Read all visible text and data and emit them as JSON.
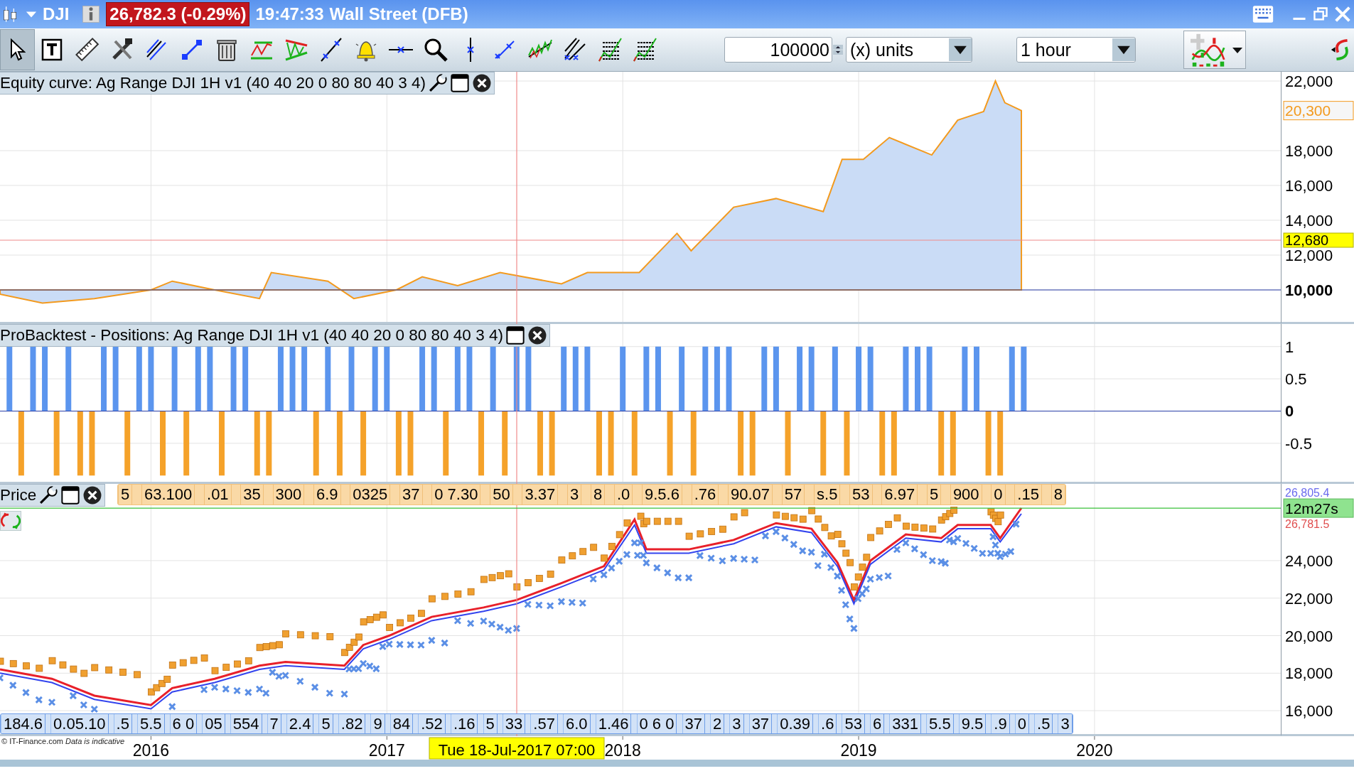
{
  "title_bar": {
    "symbol": "DJI",
    "price": "26,782.3 (-0.29%)",
    "time": "19:47:33",
    "market": "Wall Street (DFB)"
  },
  "toolbar": {
    "tools": [
      {
        "kind": "pointer",
        "selected": true
      },
      {
        "kind": "text",
        "selected": false
      },
      {
        "kind": "ruler",
        "selected": false
      },
      {
        "kind": "tools",
        "selected": false
      },
      {
        "kind": "parallel",
        "selected": false
      },
      {
        "kind": "segment",
        "selected": false
      },
      {
        "kind": "trash",
        "selected": false
      },
      {
        "kind": "channel",
        "selected": false
      },
      {
        "kind": "triangle",
        "selected": false
      },
      {
        "kind": "trendline",
        "selected": false
      },
      {
        "kind": "alert",
        "selected": false
      },
      {
        "kind": "hline",
        "selected": false
      },
      {
        "kind": "zoom",
        "selected": false
      },
      {
        "kind": "vline",
        "selected": false
      },
      {
        "kind": "ray",
        "selected": false
      },
      {
        "kind": "wave",
        "selected": false
      },
      {
        "kind": "fan",
        "selected": false
      },
      {
        "kind": "levels",
        "selected": false
      },
      {
        "kind": "levels",
        "selected": false
      }
    ],
    "quantity": {
      "value": "100000",
      "unit": "(x) units"
    },
    "timeframe": "1 hour"
  },
  "panels": [
    {
      "kind": "equity",
      "title": "Equity curve: Ag Range DJI 1H v1 (40 40 20 0 80 80 40 3 4)",
      "header_buttons": [
        {
          "kind": "settings"
        },
        {
          "kind": "maximize"
        },
        {
          "kind": "close"
        }
      ],
      "cursor_value": "12,680",
      "chart_data": {
        "type": "area",
        "x": [
          2015.36,
          2015.54,
          2015.76,
          2016.0,
          2016.09,
          2016.27,
          2016.46,
          2016.51,
          2016.75,
          2016.86,
          2017.04,
          2017.15,
          2017.3,
          2017.48,
          2017.74,
          2017.85,
          2018.07,
          2018.23,
          2018.29,
          2018.47,
          2018.65,
          2018.85,
          2018.93,
          2019.02,
          2019.13,
          2019.31,
          2019.42,
          2019.53,
          2019.58,
          2019.62,
          2019.69
        ],
        "series": [
          {
            "color": "#cadcf6",
            "values": [
              9750,
              9250,
              9500,
              10000,
              10500,
              10000,
              9500,
              11000,
              10500,
              9500,
              10000,
              10750,
              10250,
              11000,
              10350,
              11000,
              11000,
              13250,
              12250,
              14750,
              15250,
              14500,
              17500,
              17500,
              18750,
              17750,
              19750,
              20250,
              22000,
              20750,
              20300
            ]
          }
        ],
        "xlim": [
          2015.36,
          2021.1
        ],
        "ylim": [
          8040,
          22530
        ],
        "grid": true,
        "yticks": [
          {
            "value": 10000,
            "label": "10,000"
          },
          {
            "value": 12000,
            "label": "12,000"
          },
          {
            "value": 14000,
            "label": "14,000"
          },
          {
            "value": 16000,
            "label": "16,000"
          },
          {
            "value": 18000,
            "label": "18,000"
          },
          {
            "value": 22000,
            "label": "22,000"
          }
        ],
        "annotations": [
          "20,300"
        ]
      }
    },
    {
      "kind": "positions",
      "title": "ProBacktest - Positions: Ag Range DJI 1H v1 (40 40 20 0 80 80 40 3 4)",
      "header_buttons": [
        {
          "kind": "maximize"
        },
        {
          "kind": "close"
        }
      ],
      "chart_data": {
        "type": "bar",
        "x": [
          2015.4,
          2015.45,
          2015.5,
          2015.55,
          2015.6,
          2015.65,
          2015.7,
          2015.75,
          2015.8,
          2015.85,
          2015.9,
          2015.95,
          2016.0,
          2016.05,
          2016.1,
          2016.15,
          2016.2,
          2016.25,
          2016.3,
          2016.35,
          2016.4,
          2016.45,
          2016.5,
          2016.55,
          2016.6,
          2016.65,
          2016.7,
          2016.75,
          2016.8,
          2016.85,
          2016.9,
          2016.95,
          2017.0,
          2017.05,
          2017.1,
          2017.15,
          2017.2,
          2017.25,
          2017.3,
          2017.35,
          2017.4,
          2017.45,
          2017.5,
          2017.55,
          2017.6,
          2017.65,
          2017.7,
          2017.75,
          2017.8,
          2017.85,
          2017.9,
          2017.95,
          2018.0,
          2018.05,
          2018.1,
          2018.15,
          2018.2,
          2018.25,
          2018.3,
          2018.35,
          2018.4,
          2018.45,
          2018.5,
          2018.55,
          2018.6,
          2018.65,
          2018.7,
          2018.75,
          2018.8,
          2018.85,
          2018.9,
          2018.95,
          2019.0,
          2019.05,
          2019.1,
          2019.15,
          2019.2,
          2019.25,
          2019.3,
          2019.35,
          2019.4,
          2019.45,
          2019.5,
          2019.55,
          2019.6,
          2019.65,
          2019.7
        ],
        "series": [
          {
            "color": "#5b95ee",
            "values": [
              1,
              null,
              1,
              1,
              null,
              1,
              null,
              null,
              1,
              1,
              null,
              1,
              1,
              null,
              1,
              null,
              1,
              1,
              null,
              1,
              1,
              null,
              null,
              1,
              1,
              1,
              null,
              1,
              null,
              1,
              null,
              1,
              1,
              null,
              null,
              1,
              1,
              null,
              1,
              1,
              null,
              1,
              null,
              1,
              1,
              null,
              null,
              1,
              1,
              1,
              null,
              null,
              1,
              null,
              1,
              1,
              null,
              1,
              null,
              1,
              1,
              1,
              null,
              null,
              1,
              1,
              null,
              1,
              1,
              null,
              1,
              null,
              1,
              1,
              null,
              null,
              1,
              1,
              1,
              null,
              null,
              1,
              1,
              null,
              null,
              1,
              1
            ]
          },
          {
            "color": "#f5a22a",
            "values": [
              null,
              -1,
              null,
              null,
              -1,
              null,
              -1,
              -1,
              null,
              null,
              -1,
              null,
              null,
              -1,
              null,
              -1,
              null,
              null,
              -1,
              null,
              null,
              -1,
              -1,
              null,
              null,
              null,
              -1,
              null,
              -1,
              null,
              -1,
              null,
              null,
              -1,
              -1,
              null,
              null,
              -1,
              null,
              null,
              -1,
              null,
              -1,
              null,
              null,
              -1,
              -1,
              null,
              null,
              null,
              -1,
              -1,
              null,
              -1,
              null,
              null,
              -1,
              null,
              -1,
              null,
              null,
              null,
              -1,
              -1,
              null,
              null,
              -1,
              null,
              null,
              -1,
              null,
              -1,
              null,
              null,
              -1,
              -1,
              null,
              null,
              null,
              -1,
              -1,
              null,
              null,
              -1,
              -1,
              null,
              null
            ]
          }
        ],
        "xlim": [
          2015.36,
          2021.1
        ],
        "ylim": [
          -1.13,
          1.35
        ],
        "grid": true,
        "yticks": [
          {
            "value": 1,
            "label": "1"
          },
          {
            "value": 0.5,
            "label": "0.5"
          },
          {
            "value": 0,
            "label": "0"
          },
          {
            "value": -0.5,
            "label": "-0.5"
          }
        ]
      }
    },
    {
      "kind": "price",
      "title": "Price",
      "header_buttons": [
        {
          "kind": "settings"
        },
        {
          "kind": "maximize"
        },
        {
          "kind": "close"
        }
      ],
      "countdown": "12m27s",
      "cursor_time": "Tue 18-Jul-2017 07:00",
      "top_labels": [
        "5",
        "63.100",
        ".01",
        "35",
        "300",
        "6.9",
        "0325",
        "37",
        "0 7.30",
        "50",
        "3.37",
        "3",
        "8",
        ".0",
        "9.5.6",
        ".76",
        "90.07",
        "57",
        "s.5",
        "53",
        "6.97",
        "5",
        "900",
        "0",
        ".15",
        "8"
      ],
      "bottom_labels": [
        "184.6",
        "0.05.10",
        ".5",
        "5.5",
        "6 0",
        "05",
        "554",
        "7",
        "2.4",
        "5",
        ".82",
        "9",
        "84",
        ".52",
        ".16",
        "5",
        "33",
        ".57",
        "6.0",
        "1.46",
        "0 6 0",
        "37",
        "2",
        "3",
        "37",
        "0.39",
        ".6",
        "53",
        "6",
        "331",
        "5.5",
        "9.5",
        ".9",
        "0",
        ".5",
        "3"
      ],
      "note": "© IT-Finance.com *Data is indicative*",
      "chart_data": {
        "type": "line",
        "x": [
          2015.36,
          2015.58,
          2015.76,
          2016.0,
          2016.09,
          2016.27,
          2016.46,
          2016.57,
          2016.82,
          2016.9,
          2017.01,
          2017.19,
          2017.41,
          2017.55,
          2017.74,
          2017.92,
          2018.05,
          2018.1,
          2018.28,
          2018.47,
          2018.65,
          2018.8,
          2018.91,
          2018.98,
          2019.05,
          2019.2,
          2019.35,
          2019.42,
          2019.56,
          2019.6,
          2019.69
        ],
        "series": [
          {
            "color": "#e8202a",
            "values": [
              18200,
              17700,
              16800,
              16300,
              17200,
              17700,
              18400,
              18600,
              18400,
              19500,
              20000,
              21000,
              21500,
              21900,
              22800,
              23700,
              26200,
              24600,
              24600,
              25100,
              26000,
              25700,
              23900,
              21900,
              24000,
              25400,
              25200,
              25900,
              25900,
              25200,
              26800
            ]
          },
          {
            "color": "#3344ee",
            "values": [
              18000,
              17500,
              16600,
              16100,
              17000,
              17500,
              18200,
              18400,
              18200,
              19300,
              19800,
              20800,
              21300,
              21700,
              22600,
              23500,
              25900,
              24400,
              24400,
              24900,
              25800,
              25500,
              23700,
              21700,
              23800,
              25200,
              25000,
              25700,
              25700,
              25000,
              26500
            ]
          }
        ],
        "xlim": [
          2015.36,
          2021.1
        ],
        "ylim": [
          14640,
          28090
        ],
        "grid": true,
        "xticks": [
          {
            "value": 2016,
            "label": "2016"
          },
          {
            "value": 2017,
            "label": "2017"
          },
          {
            "value": 2018,
            "label": "2018"
          },
          {
            "value": 2019,
            "label": "2019"
          },
          {
            "value": 2020,
            "label": "2020"
          }
        ],
        "yticks": [
          {
            "value": 16000,
            "label": "16,000"
          },
          {
            "value": 18000,
            "label": "18,000"
          },
          {
            "value": 20000,
            "label": "20,000"
          },
          {
            "value": 22000,
            "label": "22,000"
          },
          {
            "value": 24000,
            "label": "24,000"
          }
        ],
        "annotations": [
          "26,805.4",
          "26,781.5"
        ]
      }
    }
  ]
}
